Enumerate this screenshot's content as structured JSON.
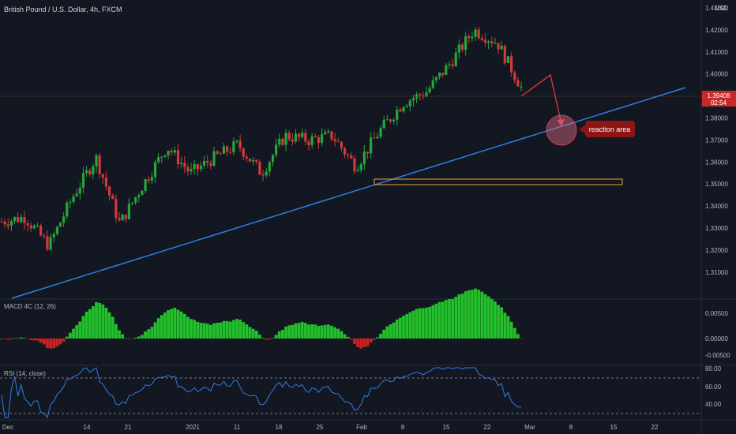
{
  "header": {
    "title": "British Pound / U.S. Dollar, 4h, FXCM"
  },
  "price_axis": {
    "currency": "USD",
    "ticks": [
      "1.43000",
      "1.42000",
      "1.41000",
      "1.40000",
      "1.39000",
      "1.38000",
      "1.37000",
      "1.36000",
      "1.35000",
      "1.34000",
      "1.33000",
      "1.32000",
      "1.31000"
    ],
    "current_price": "1.39408",
    "countdown": "02:54"
  },
  "annotation": {
    "reaction_label": "reaction area"
  },
  "macd": {
    "label": "MACD 4C (12, 26)",
    "ticks": [
      "0.00500",
      "0.00000",
      "-0.00500"
    ]
  },
  "rsi": {
    "label": "RSI (14, close)",
    "ticks": [
      "80.00",
      "60.00",
      "40.00"
    ]
  },
  "time_axis": {
    "ticks": [
      "Dec",
      "14",
      "21",
      "2021",
      "11",
      "18",
      "25",
      "Feb",
      "8",
      "15",
      "22",
      "Mar",
      "8",
      "15",
      "22"
    ]
  },
  "colors": {
    "background": "#131722",
    "up_candle": "#26a63a",
    "down_candle": "#d23a3a",
    "trendline": "#2f7fe0",
    "zone_box": "#e8a23a",
    "price_label": "#c62b2b",
    "macd_up": "#22c02a",
    "macd_down": "#d01f1f",
    "rsi_line": "#2f7fe0"
  },
  "chart_data": [
    {
      "type": "candlestick",
      "title": "British Pound / U.S. Dollar, 4h, FXCM",
      "ylabel": "USD",
      "ylim": [
        1.3,
        1.435
      ],
      "x": [
        "Dec",
        "14",
        "21",
        "2021",
        "11",
        "18",
        "25",
        "Feb",
        "8",
        "15",
        "22",
        "Mar",
        "8",
        "15",
        "22"
      ],
      "approx_close_path": [
        {
          "date": "Dec",
          "close": 1.333
        },
        {
          "date": "Dec 10",
          "close": 1.335
        },
        {
          "date": "Dec 12",
          "close": 1.322
        },
        {
          "date": "Dec 14",
          "close": 1.344
        },
        {
          "date": "Dec 17",
          "close": 1.362
        },
        {
          "date": "Dec 21",
          "close": 1.332
        },
        {
          "date": "Dec 23",
          "close": 1.35
        },
        {
          "date": "2021",
          "close": 1.367
        },
        {
          "date": "Jan 6",
          "close": 1.355
        },
        {
          "date": "Jan 11",
          "close": 1.362
        },
        {
          "date": "Jan 14",
          "close": 1.368
        },
        {
          "date": "Jan 18",
          "close": 1.355
        },
        {
          "date": "Jan 21",
          "close": 1.372
        },
        {
          "date": "Jan 25",
          "close": 1.37
        },
        {
          "date": "Feb",
          "close": 1.372
        },
        {
          "date": "Feb 4",
          "close": 1.358
        },
        {
          "date": "Feb 8",
          "close": 1.374
        },
        {
          "date": "Feb 15",
          "close": 1.387
        },
        {
          "date": "Feb 17",
          "close": 1.392
        },
        {
          "date": "Feb 22",
          "close": 1.405
        },
        {
          "date": "Feb 24",
          "close": 1.42
        },
        {
          "date": "Feb 25",
          "close": 1.414
        },
        {
          "date": "Feb 26",
          "close": 1.394
        }
      ],
      "last_price": 1.39408,
      "annotations": [
        "reaction area"
      ]
    },
    {
      "type": "bar",
      "title": "MACD 4C (12, 26)",
      "ylim": [
        -0.005,
        0.0075
      ],
      "ticks": [
        "0.00500",
        "0.00000",
        "-0.00500"
      ]
    },
    {
      "type": "line",
      "title": "RSI (14, close)",
      "ylim": [
        30,
        82
      ],
      "ticks": [
        "80.00",
        "60.00",
        "40.00"
      ]
    }
  ]
}
